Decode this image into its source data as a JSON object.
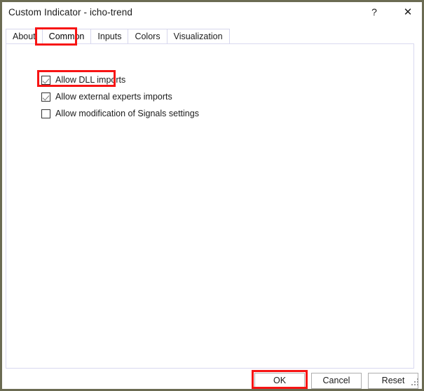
{
  "window": {
    "title": "Custom Indicator - icho-trend",
    "frame_color": "#6b6b52",
    "background": "#ffffff",
    "caption_buttons": [
      {
        "name": "help-button",
        "icon": "help-icon",
        "glyph": "?"
      },
      {
        "name": "close-button",
        "icon": "close-icon",
        "glyph": "✕"
      }
    ]
  },
  "tabs": {
    "selected": "Common",
    "items": [
      {
        "label": "About",
        "selected": false
      },
      {
        "label": "Common",
        "selected": true
      },
      {
        "label": "Inputs",
        "selected": false
      },
      {
        "label": "Colors",
        "selected": false
      },
      {
        "label": "Visualization",
        "selected": false
      }
    ]
  },
  "common_tab": {
    "options": [
      {
        "label": "Allow DLL imports",
        "checked": true
      },
      {
        "label": "Allow external experts imports",
        "checked": true
      },
      {
        "label": "Allow modification of Signals settings",
        "checked": false
      }
    ]
  },
  "buttons": {
    "ok": "OK",
    "cancel": "Cancel",
    "reset": "Reset"
  },
  "annotations": {
    "color": "#f71414",
    "targets": [
      "common-tab",
      "allow-dll-imports-option",
      "ok-button"
    ]
  }
}
